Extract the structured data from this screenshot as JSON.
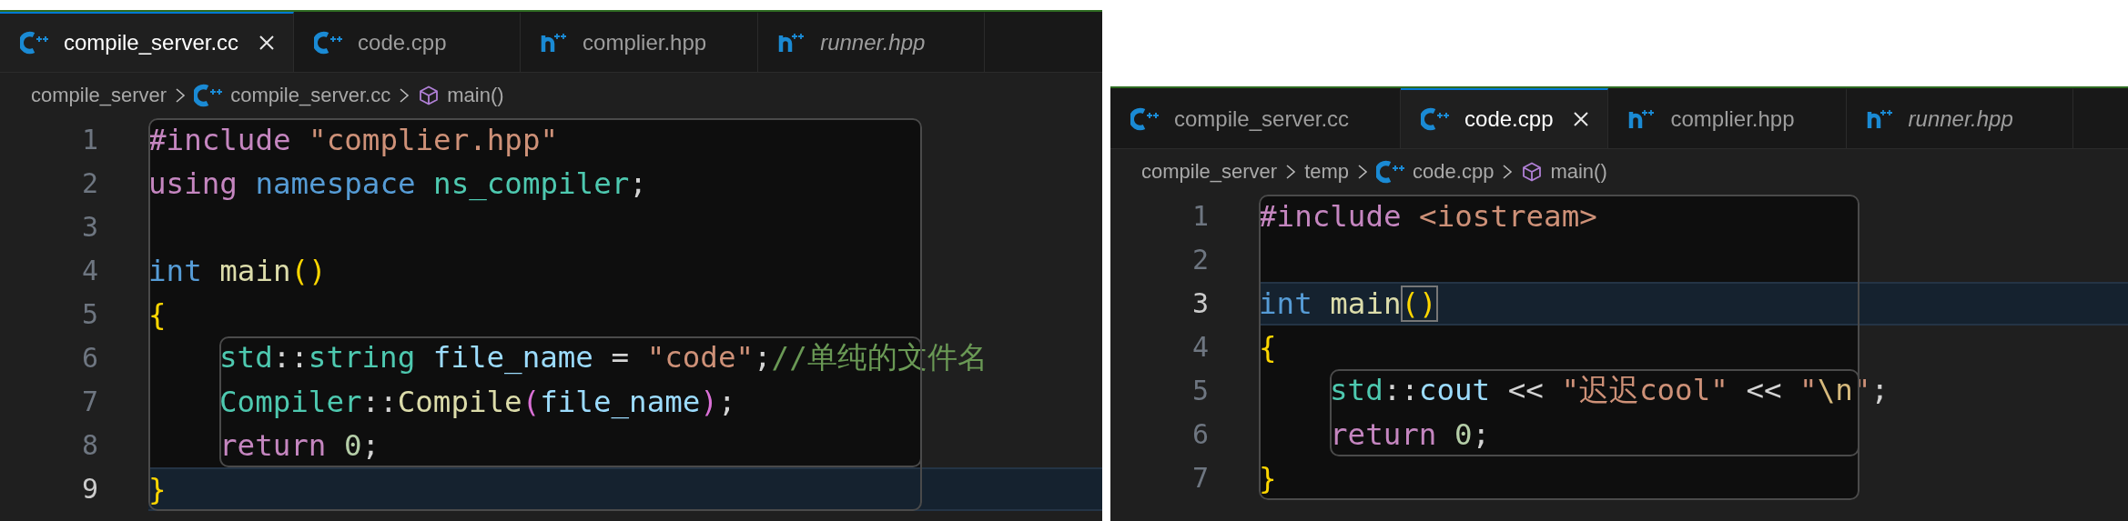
{
  "panes": [
    {
      "tabs": [
        {
          "label": "compile_server.cc",
          "kind": "cpp",
          "selected": true,
          "italic": false
        },
        {
          "label": "code.cpp",
          "kind": "cpp",
          "selected": false,
          "italic": false
        },
        {
          "label": "complier.hpp",
          "kind": "hpp",
          "selected": false,
          "italic": false
        },
        {
          "label": "runner.hpp",
          "kind": "hpp",
          "selected": false,
          "italic": true
        }
      ],
      "breadcrumb": [
        {
          "label": "compile_server",
          "kind": "folder"
        },
        {
          "label": "compile_server.cc",
          "kind": "cpp"
        },
        {
          "label": "main()",
          "kind": "symbol"
        }
      ],
      "code": {
        "kind": "block",
        "children": [
          {
            "kind": "line",
            "number": "1",
            "current": false,
            "tokens": [
              {
                "text": "#include",
                "kind": "directive"
              },
              {
                "text": " \"complier.hpp\"",
                "kind": "string"
              }
            ]
          },
          {
            "kind": "line",
            "number": "2",
            "current": false,
            "tokens": [
              {
                "text": "using",
                "kind": "directive"
              },
              {
                "text": " namespace",
                "kind": "storage"
              },
              {
                "text": " ns_compiler",
                "kind": "type"
              },
              {
                "text": ";",
                "kind": "plain"
              }
            ]
          },
          {
            "kind": "line",
            "number": "3",
            "current": false
          },
          {
            "kind": "line",
            "number": "4",
            "current": false,
            "tokens": [
              {
                "text": "int",
                "kind": "storage"
              },
              {
                "text": " main",
                "kind": "function"
              },
              {
                "text": "()",
                "kind": "bracket1"
              }
            ]
          },
          {
            "kind": "line",
            "number": "5",
            "current": false,
            "tokens": [
              {
                "text": "{",
                "kind": "bracket1"
              }
            ]
          },
          {
            "kind": "block",
            "children": [
              {
                "kind": "line",
                "number": "6",
                "current": false,
                "tokens": [
                  {
                    "text": "std",
                    "kind": "type"
                  },
                  {
                    "text": "::",
                    "kind": "plain"
                  },
                  {
                    "text": "string",
                    "kind": "type"
                  },
                  {
                    "text": " file_name",
                    "kind": "variable"
                  },
                  {
                    "text": " = ",
                    "kind": "plain"
                  },
                  {
                    "text": "\"code\"",
                    "kind": "string"
                  },
                  {
                    "text": ";",
                    "kind": "plain"
                  },
                  {
                    "text": "//单纯的文件名",
                    "kind": "comment"
                  }
                ]
              },
              {
                "kind": "line",
                "number": "7",
                "current": false,
                "tokens": [
                  {
                    "text": "Compiler",
                    "kind": "type"
                  },
                  {
                    "text": "::",
                    "kind": "plain"
                  },
                  {
                    "text": "Compile",
                    "kind": "function"
                  },
                  {
                    "text": "(",
                    "kind": "bracket2"
                  },
                  {
                    "text": "file_name",
                    "kind": "variable"
                  },
                  {
                    "text": ")",
                    "kind": "bracket2"
                  },
                  {
                    "text": ";",
                    "kind": "plain"
                  }
                ]
              },
              {
                "kind": "line",
                "number": "8",
                "current": false,
                "tokens": [
                  {
                    "text": "return",
                    "kind": "directive"
                  },
                  {
                    "text": " 0",
                    "kind": "number"
                  },
                  {
                    "text": ";",
                    "kind": "plain"
                  }
                ]
              }
            ]
          },
          {
            "kind": "line",
            "number": "9",
            "current": true,
            "tokens": [
              {
                "text": "}",
                "kind": "bracket1"
              }
            ]
          }
        ]
      }
    },
    {
      "tabs": [
        {
          "label": "compile_server.cc",
          "kind": "cpp",
          "selected": false,
          "italic": false
        },
        {
          "label": "code.cpp",
          "kind": "cpp",
          "selected": true,
          "italic": false
        },
        {
          "label": "complier.hpp",
          "kind": "hpp",
          "selected": false,
          "italic": false
        },
        {
          "label": "runner.hpp",
          "kind": "hpp",
          "selected": false,
          "italic": true
        }
      ],
      "breadcrumb": [
        {
          "label": "compile_server",
          "kind": "folder"
        },
        {
          "label": "temp",
          "kind": "folder"
        },
        {
          "label": "code.cpp",
          "kind": "cpp"
        },
        {
          "label": "main()",
          "kind": "symbol"
        }
      ],
      "code": {
        "kind": "block",
        "children": [
          {
            "kind": "line",
            "number": "1",
            "current": false,
            "tokens": [
              {
                "text": "#include",
                "kind": "directive"
              },
              {
                "text": " <iostream>",
                "kind": "string"
              }
            ]
          },
          {
            "kind": "line",
            "number": "2",
            "current": false
          },
          {
            "kind": "line",
            "number": "3",
            "current": true,
            "tokens": [
              {
                "text": "int",
                "kind": "storage"
              },
              {
                "text": " main",
                "kind": "function"
              },
              {
                "text": "()",
                "kind": "bracket1",
                "matched": true
              }
            ]
          },
          {
            "kind": "line",
            "number": "4",
            "current": false,
            "tokens": [
              {
                "text": "{",
                "kind": "bracket1"
              }
            ]
          },
          {
            "kind": "block",
            "children": [
              {
                "kind": "line",
                "number": "5",
                "current": false,
                "tokens": [
                  {
                    "text": "std",
                    "kind": "type"
                  },
                  {
                    "text": "::",
                    "kind": "plain"
                  },
                  {
                    "text": "cout",
                    "kind": "variable"
                  },
                  {
                    "text": " << ",
                    "kind": "plain"
                  },
                  {
                    "text": "\"迟迟cool\"",
                    "kind": "string"
                  },
                  {
                    "text": " << ",
                    "kind": "plain"
                  },
                  {
                    "text": "\"",
                    "kind": "string"
                  },
                  {
                    "text": "\\n",
                    "kind": "escape"
                  },
                  {
                    "text": "\"",
                    "kind": "string"
                  },
                  {
                    "text": ";",
                    "kind": "plain"
                  }
                ]
              },
              {
                "kind": "line",
                "number": "6",
                "current": false,
                "tokens": [
                  {
                    "text": "return",
                    "kind": "directive"
                  },
                  {
                    "text": " 0",
                    "kind": "number"
                  },
                  {
                    "text": ";",
                    "kind": "plain"
                  }
                ]
              }
            ]
          },
          {
            "kind": "line",
            "number": "7",
            "current": false,
            "tokens": [
              {
                "text": "}",
                "kind": "bracket1"
              }
            ]
          }
        ]
      }
    }
  ]
}
